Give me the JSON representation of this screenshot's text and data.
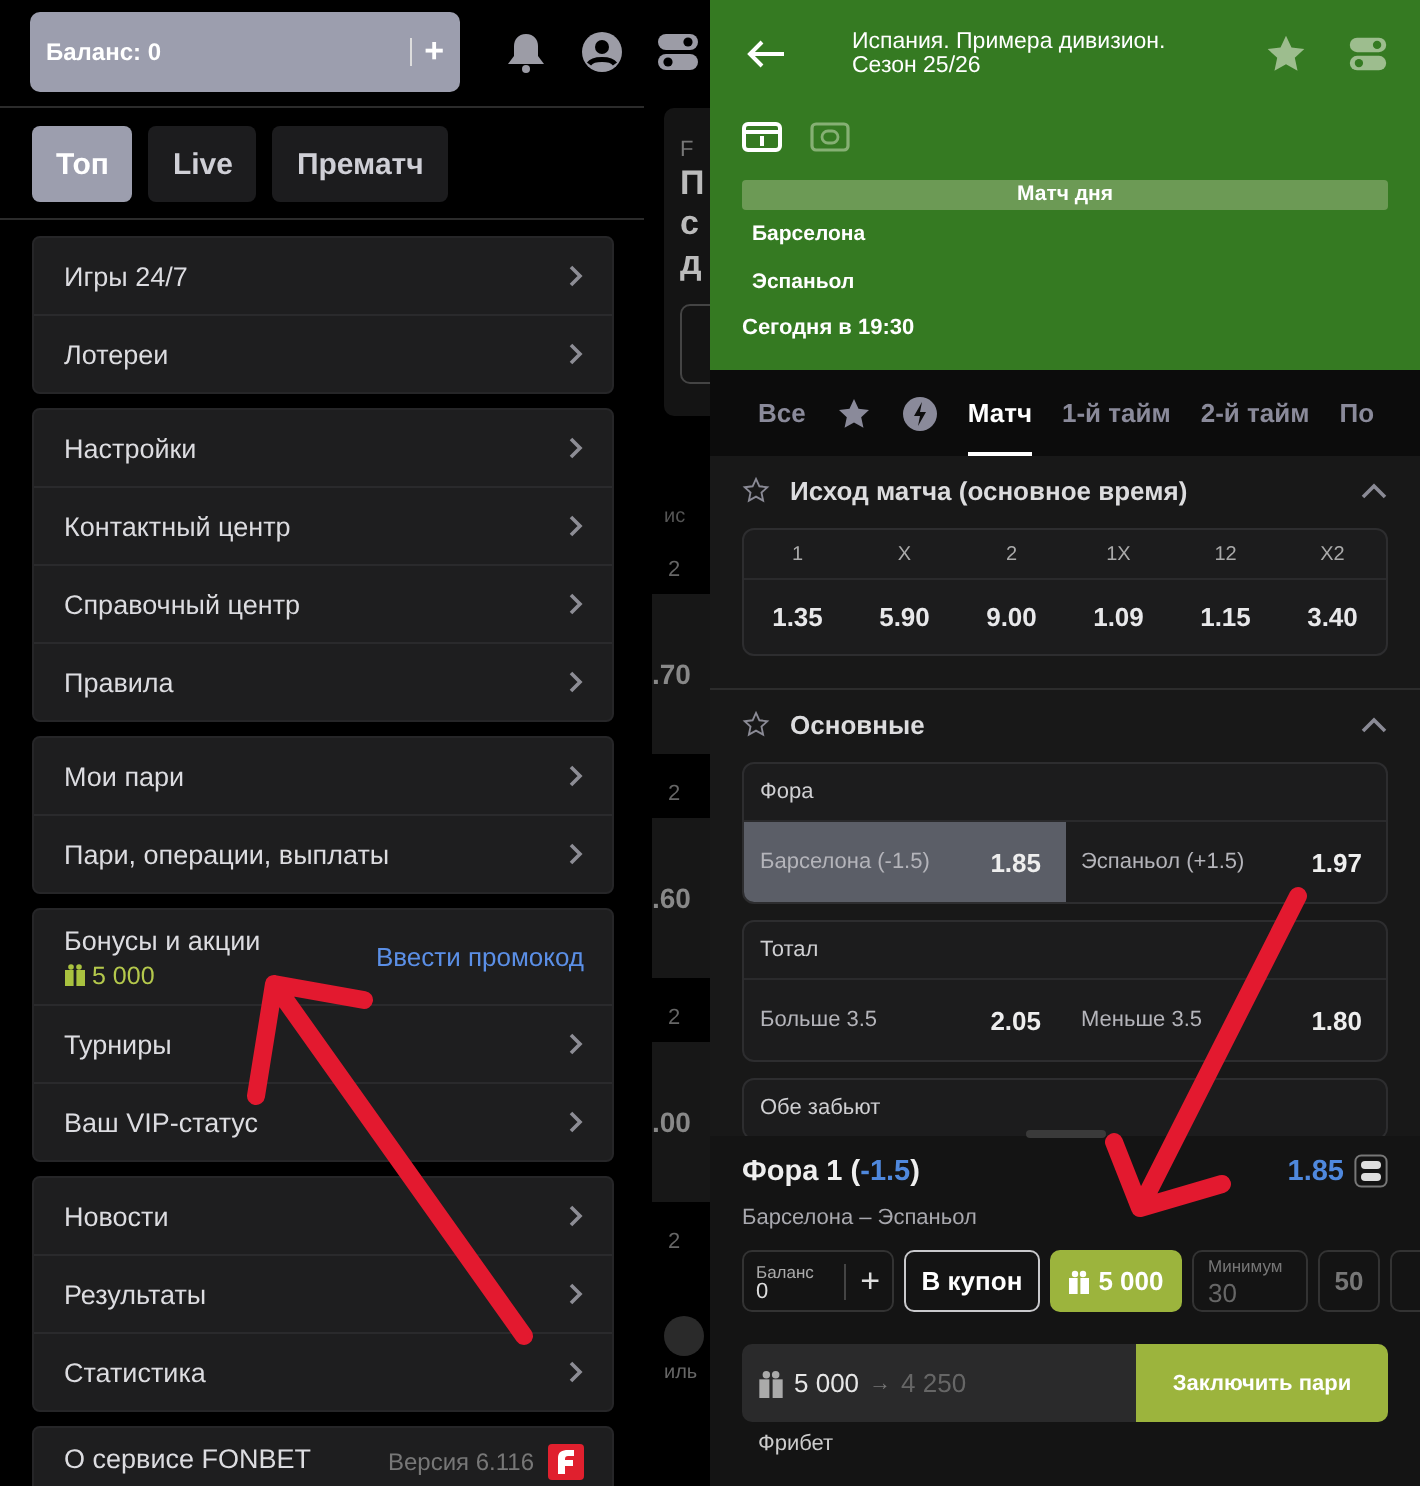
{
  "left": {
    "balance": {
      "label": "Баланс: 0",
      "plus": "+"
    },
    "tabs": [
      {
        "label": "Топ",
        "selected": true
      },
      {
        "label": "Live",
        "selected": false
      },
      {
        "label": "Прематч",
        "selected": false
      }
    ],
    "menu_groups": [
      {
        "items": [
          {
            "kind": "link",
            "label": "Игры 24/7"
          },
          {
            "kind": "link",
            "label": "Лотереи"
          }
        ]
      },
      {
        "items": [
          {
            "kind": "link",
            "label": "Настройки"
          },
          {
            "kind": "link",
            "label": "Контактный центр"
          },
          {
            "kind": "link",
            "label": "Справочный центр"
          },
          {
            "kind": "link",
            "label": "Правила"
          }
        ]
      },
      {
        "items": [
          {
            "kind": "link",
            "label": "Мои пари"
          },
          {
            "kind": "link",
            "label": "Пари, операции, выплаты"
          }
        ]
      },
      {
        "items": [
          {
            "kind": "bonus",
            "label": "Бонусы и акции",
            "amount": "5 000",
            "action": "Ввести промокод"
          },
          {
            "kind": "link",
            "label": "Турниры"
          },
          {
            "kind": "link",
            "label": "Ваш VIP-статус"
          }
        ]
      },
      {
        "items": [
          {
            "kind": "link",
            "label": "Новости"
          },
          {
            "kind": "link",
            "label": "Результаты"
          },
          {
            "kind": "link",
            "label": "Статистика"
          }
        ]
      },
      {
        "items": [
          {
            "kind": "about",
            "label": "О сервисе FONBET",
            "version": "Версия 6.116"
          }
        ]
      }
    ],
    "background_page": {
      "card_lines": [
        "F",
        "П",
        "с",
        "д"
      ],
      "column_heads": [
        "ис"
      ],
      "rows": [
        {
          "label": "2",
          "odd": ".70"
        },
        {
          "label": "2",
          "odd": ".60"
        },
        {
          "label": "2",
          "odd": ".00"
        },
        {
          "label": "2"
        }
      ],
      "nav_label": "иль"
    }
  },
  "right": {
    "match": {
      "title": "Испания. Примера дивизион.",
      "subtitle": "Сезон 25/26",
      "views": [
        {
          "kind": "panel",
          "selected": true
        },
        {
          "kind": "screen",
          "selected": false
        }
      ],
      "banner": "Матч дня",
      "team_1": "Барселона",
      "team_2": "Эспаньол",
      "start": "Сегодня в 19:30"
    },
    "market_tabs": [
      {
        "kind": "text",
        "label": "Все",
        "selected": false
      },
      {
        "kind": "favorites",
        "selected": false
      },
      {
        "kind": "fast",
        "selected": false
      },
      {
        "kind": "text",
        "label": "Матч",
        "selected": true
      },
      {
        "kind": "text",
        "label": "1-й тайм",
        "selected": false
      },
      {
        "kind": "text",
        "label": "2-й тайм",
        "selected": false
      },
      {
        "kind": "text",
        "label": "По",
        "selected": false
      }
    ],
    "sections": [
      {
        "kind": "grid",
        "title": "Исход матча (основное время)",
        "expanded": true,
        "outcomes": [
          {
            "label": "1",
            "odd": "1.35"
          },
          {
            "label": "X",
            "odd": "5.90"
          },
          {
            "label": "2",
            "odd": "9.00"
          },
          {
            "label": "1X",
            "odd": "1.09"
          },
          {
            "label": "12",
            "odd": "1.15"
          },
          {
            "label": "X2",
            "odd": "3.40"
          }
        ]
      },
      {
        "kind": "markets",
        "title": "Основные",
        "expanded": true,
        "markets": [
          {
            "name": "Фора",
            "outcomes": [
              {
                "label": "Барселона (-1.5)",
                "odd": "1.85",
                "selected": true
              },
              {
                "label": "Эспаньол (+1.5)",
                "odd": "1.97",
                "selected": false
              }
            ]
          },
          {
            "name": "Тотал",
            "outcomes": [
              {
                "label": "Больше 3.5",
                "odd": "2.05",
                "selected": false
              },
              {
                "label": "Меньше 3.5",
                "odd": "1.80",
                "selected": false
              }
            ]
          },
          {
            "name": "Обе забьют"
          }
        ]
      }
    ],
    "bet_slip": {
      "title_parts": [
        {
          "text": "Фора 1 (",
          "highlight": false
        },
        {
          "text": "-1.5",
          "highlight": true
        },
        {
          "text": ")",
          "highlight": false
        }
      ],
      "odd": "1.85",
      "event": "Барселона – Эспаньол",
      "balance": {
        "label": "Баланс",
        "value": "0",
        "plus": "+"
      },
      "coupon_button": "В купон",
      "freebet_button": "5 000",
      "stake": {
        "label": "Минимум",
        "placeholder": "30"
      },
      "quick_stakes": [
        "50"
      ],
      "freebet_amount": "5 000",
      "arrow": "→",
      "remaining": "4 250",
      "submit": "Заключить пари",
      "freebet_label": "Фрибет"
    }
  }
}
